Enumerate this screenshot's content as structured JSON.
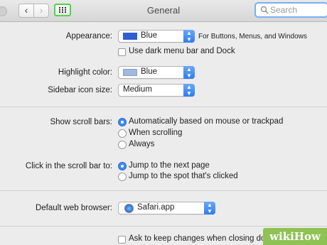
{
  "window": {
    "title": "General"
  },
  "toolbar": {
    "back_label": "‹",
    "forward_label": "›",
    "search_placeholder": "Search"
  },
  "appearance": {
    "label": "Appearance:",
    "value": "Blue",
    "swatch_color": "#2c5fd2",
    "note": "For Buttons, Menus, and Windows",
    "dark_menu_label": "Use dark menu bar and Dock"
  },
  "highlight": {
    "label": "Highlight color:",
    "value": "Blue",
    "swatch_color": "#9fb8e2"
  },
  "sidebar_icon": {
    "label": "Sidebar icon size:",
    "value": "Medium"
  },
  "scroll_bars": {
    "label": "Show scroll bars:",
    "options": [
      "Automatically based on mouse or trackpad",
      "When scrolling",
      "Always"
    ],
    "selected": 0
  },
  "scroll_click": {
    "label": "Click in the scroll bar to:",
    "options": [
      "Jump to the next page",
      "Jump to the spot that's clicked"
    ],
    "selected": 0
  },
  "browser": {
    "label": "Default web browser:",
    "value": "Safari.app"
  },
  "ask_changes": {
    "label": "Ask to keep changes when closing documents"
  },
  "watermark": "wikiHow",
  "colors": {
    "accent": "#3c88f3",
    "highlight_border": "#4ed54b"
  }
}
